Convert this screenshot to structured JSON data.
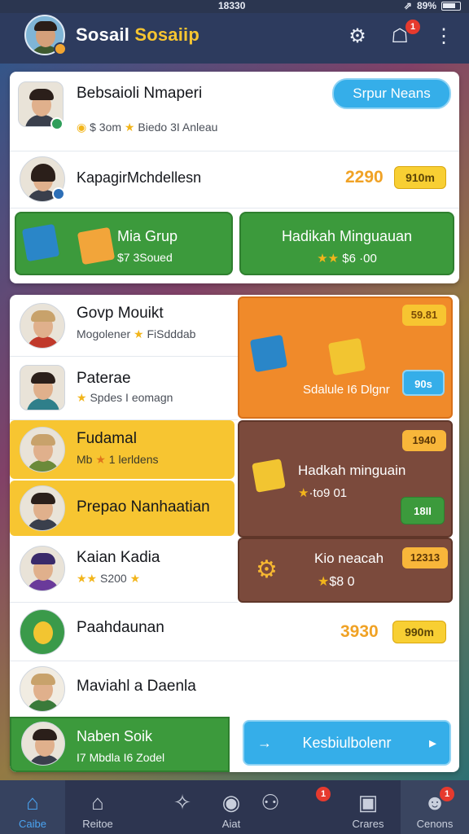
{
  "status": {
    "time": "18330",
    "battery": "89%"
  },
  "header": {
    "title_main": "Sosail ",
    "title_accent": "Sosaiip",
    "settings_icon": "gear-icon",
    "notify_icon": "bell-icon",
    "notify_count": "1",
    "menu_icon": "kebab-menu-icon"
  },
  "top_panel": {
    "row1": {
      "name": "Bebsaioli Nmaperi",
      "meta_coin": "$ 3om",
      "meta_text": "Biedo 3I Anleau",
      "button": "Srpur Neans"
    },
    "row2": {
      "name": "KapagirMchdellesn",
      "score": "2290",
      "pill": "910m"
    },
    "card_left": {
      "title": "Mia Grup",
      "sub": "$7 3Soued"
    },
    "card_right": {
      "title": "Hadikah Minguauan",
      "sub": "$6 ·00"
    }
  },
  "list": [
    {
      "name": "Govp Mouikt",
      "sub": "Mogolener",
      "sub2": "FiSdddab"
    },
    {
      "name": "Paterae",
      "sub": "Spdes I eomagn"
    },
    {
      "name": "Fudamal",
      "sub": "Mb",
      "sub2": "1 lerldens"
    },
    {
      "name": "Prepao Nanhaatian"
    },
    {
      "name": "Kaian Kadia",
      "sub": "S200"
    },
    {
      "name": "Paahdaunan",
      "score": "3930",
      "pill": "990m"
    },
    {
      "name": "Maviahl a Daenla"
    }
  ],
  "tiles": {
    "orange": {
      "tag": "59.81",
      "label": "Sdalule I6 Dlgnr",
      "button": "90s"
    },
    "brown1": {
      "tag": "1940",
      "title": "Hadkah minguain",
      "sub": "·to9 01",
      "button": "18II"
    },
    "brown2": {
      "tag": "12313",
      "title": "Kio neacah",
      "sub": "$8 0"
    }
  },
  "footer_panel": {
    "name": "Naben Soik",
    "sub": "I7 Mbdla I6 Zodel",
    "button": "Kesbiulbolenr"
  },
  "nav": [
    {
      "label": "Caibe",
      "icon": "home-icon"
    },
    {
      "label": "Reitoe",
      "icon": "house-icon"
    },
    {
      "label": "",
      "icon": "sparkle-icon"
    },
    {
      "label": "Aiat",
      "icon": "record-icon"
    },
    {
      "label": "",
      "icon": "people-icon"
    },
    {
      "label": "Crares",
      "icon": "chat-icon"
    },
    {
      "label": "Cenons",
      "icon": "profile-icon"
    }
  ],
  "colors": {
    "accent_blue": "#35aee9",
    "orange": "#f08a2a",
    "brown": "#7b4a3c",
    "yellow": "#f7c531",
    "green": "#3c9a3c"
  }
}
